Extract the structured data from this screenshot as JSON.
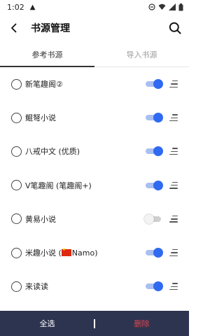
{
  "status_bar": {
    "time": "1:02",
    "warning_icon": "warning-triangle-icon"
  },
  "app_bar": {
    "title": "书源管理",
    "back_icon": "arrow-back-icon",
    "search_icon": "search-icon"
  },
  "tabs": [
    {
      "label": "参考书源",
      "active": true
    },
    {
      "label": "导入书源",
      "active": false
    }
  ],
  "sources": [
    {
      "name": "新笔趣阁②",
      "checked": false,
      "enabled": true
    },
    {
      "name": "鲲弩小说",
      "checked": false,
      "enabled": true
    },
    {
      "name": "八戒中文 (优质)",
      "checked": false,
      "enabled": true
    },
    {
      "name": "V笔趣阁 (笔趣阁+)",
      "checked": false,
      "enabled": true
    },
    {
      "name": "黄易小说",
      "checked": false,
      "enabled": false
    },
    {
      "name": "米趣小说 (",
      "name_suffix": "Namo)",
      "flag": "china-flag-icon",
      "checked": false,
      "enabled": true
    },
    {
      "name": "来读读",
      "checked": false,
      "enabled": true
    }
  ],
  "bottom_bar": {
    "select_all_label": "全选",
    "delete_label": "删除"
  },
  "colors": {
    "accent": "#2f6af0",
    "accent_track": "#a9bff1",
    "bottom_bar_bg": "#2d3450",
    "delete_text": "#e0454d"
  }
}
